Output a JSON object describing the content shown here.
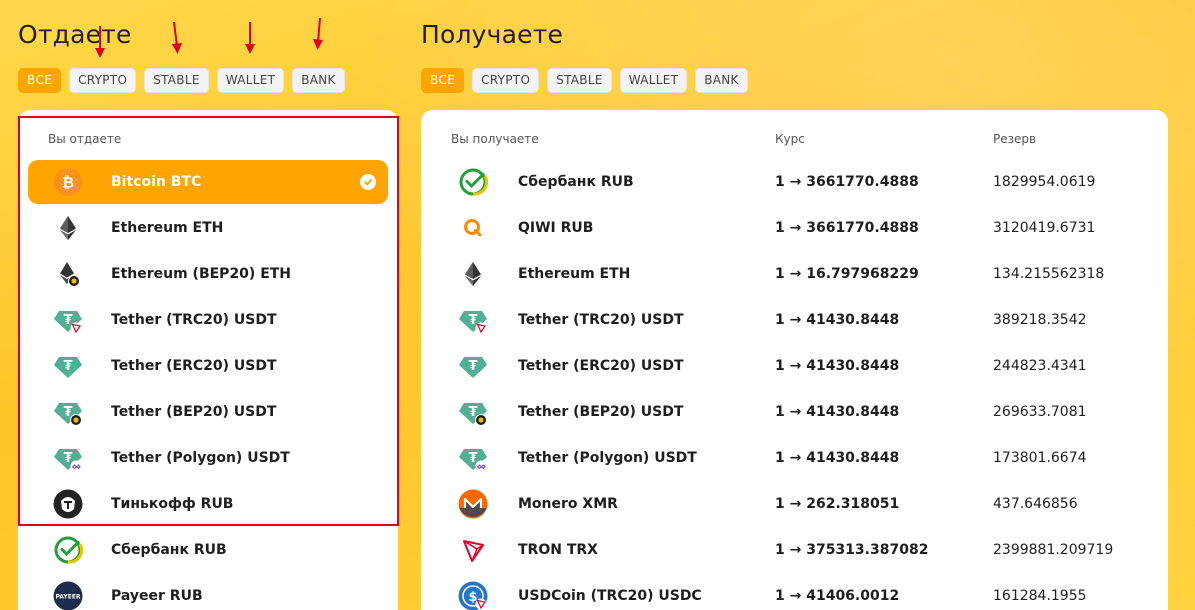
{
  "left": {
    "title": "Отдаете",
    "filters": [
      "ВСЕ",
      "CRYPTO",
      "STABLE",
      "WALLET",
      "BANK"
    ],
    "active_filter": "ВСЕ",
    "column_header": "Вы отдаете",
    "items": [
      {
        "name": "Bitcoin BTC",
        "icon": "bitcoin-icon",
        "selected": true
      },
      {
        "name": "Ethereum ETH",
        "icon": "ethereum-icon"
      },
      {
        "name": "Ethereum (BEP20) ETH",
        "icon": "ethereum-bep20-icon"
      },
      {
        "name": "Tether (TRC20) USDT",
        "icon": "tether-trc20-icon"
      },
      {
        "name": "Tether (ERC20) USDT",
        "icon": "tether-erc20-icon"
      },
      {
        "name": "Tether (BEP20) USDT",
        "icon": "tether-bep20-icon"
      },
      {
        "name": "Tether (Polygon) USDT",
        "icon": "tether-polygon-icon"
      },
      {
        "name": "Тинькофф RUB",
        "icon": "tinkoff-icon"
      },
      {
        "name": "Сбербанк RUB",
        "icon": "sberbank-icon"
      },
      {
        "name": "Payeer RUB",
        "icon": "payeer-icon"
      }
    ]
  },
  "right": {
    "title": "Получаете",
    "filters": [
      "ВСЕ",
      "CRYPTO",
      "STABLE",
      "WALLET",
      "BANK"
    ],
    "active_filter": "ВСЕ",
    "headers": {
      "name": "Вы получаете",
      "rate": "Курс",
      "reserve": "Резерв"
    },
    "items": [
      {
        "name": "Сбербанк RUB",
        "icon": "sberbank-icon",
        "rate": "1 → 3661770.4888",
        "reserve": "1829954.0619"
      },
      {
        "name": "QIWI RUB",
        "icon": "qiwi-icon",
        "rate": "1 → 3661770.4888",
        "reserve": "3120419.6731"
      },
      {
        "name": "Ethereum ETH",
        "icon": "ethereum-icon",
        "rate": "1 → 16.797968229",
        "reserve": "134.215562318"
      },
      {
        "name": "Tether (TRC20) USDT",
        "icon": "tether-trc20-icon",
        "rate": "1 → 41430.8448",
        "reserve": "389218.3542"
      },
      {
        "name": "Tether (ERC20) USDT",
        "icon": "tether-erc20-icon",
        "rate": "1 → 41430.8448",
        "reserve": "244823.4341"
      },
      {
        "name": "Tether (BEP20) USDT",
        "icon": "tether-bep20-icon",
        "rate": "1 → 41430.8448",
        "reserve": "269633.7081"
      },
      {
        "name": "Tether (Polygon) USDT",
        "icon": "tether-polygon-icon",
        "rate": "1 → 41430.8448",
        "reserve": "173801.6674"
      },
      {
        "name": "Monero XMR",
        "icon": "monero-icon",
        "rate": "1 → 262.318051",
        "reserve": "437.646856"
      },
      {
        "name": "TRON TRX",
        "icon": "tron-icon",
        "rate": "1 → 375313.387082",
        "reserve": "2399881.209719"
      },
      {
        "name": "USDCoin (TRC20) USDC",
        "icon": "usdc-icon",
        "rate": "1 → 41406.0012",
        "reserve": "161284.1955"
      }
    ]
  },
  "colors": {
    "accent": "#ffa400",
    "background": "#ffd23f",
    "annotation": "#e0001b"
  }
}
